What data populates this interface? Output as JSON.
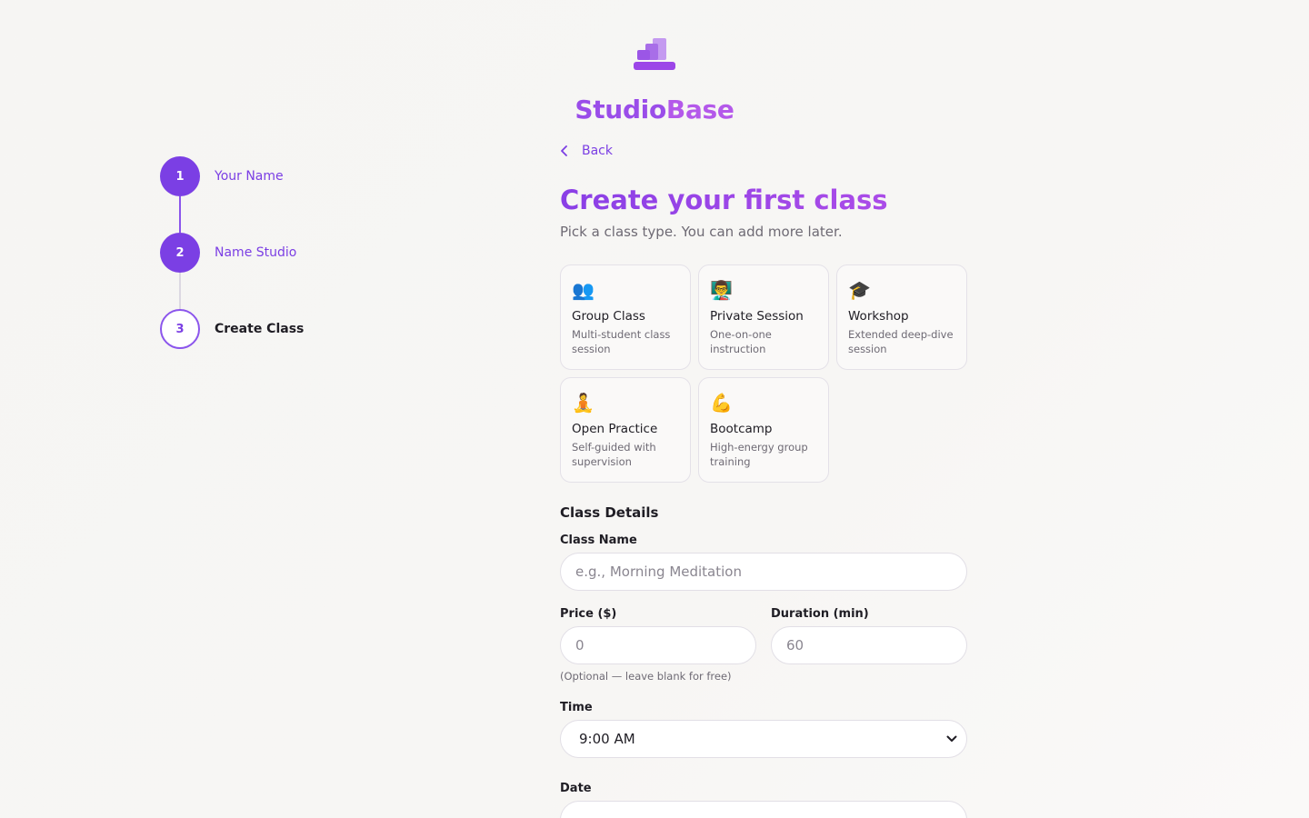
{
  "brand": {
    "name_part1": "Studio",
    "name_part2": "Base"
  },
  "stepper": {
    "steps": [
      {
        "number": "1",
        "label": "Your Name",
        "state": "done"
      },
      {
        "number": "2",
        "label": "Name Studio",
        "state": "done"
      },
      {
        "number": "3",
        "label": "Create Class",
        "state": "current"
      }
    ]
  },
  "main": {
    "back_label": "Back",
    "title": "Create your first class",
    "subtitle": "Pick a class type. You can add more later.",
    "class_types": [
      {
        "icon": "👥",
        "icon_name": "group-icon",
        "name": "Group Class",
        "desc": "Multi-student class session"
      },
      {
        "icon": "👨‍🏫",
        "icon_name": "teacher-icon",
        "name": "Private Session",
        "desc": "One-on-one instruction"
      },
      {
        "icon": "🎓",
        "icon_name": "graduation-cap-icon",
        "name": "Workshop",
        "desc": "Extended deep-dive session"
      },
      {
        "icon": "🧘",
        "icon_name": "meditation-icon",
        "name": "Open Practice",
        "desc": "Self-guided with supervision"
      },
      {
        "icon": "💪",
        "icon_name": "flexed-arm-icon",
        "name": "Bootcamp",
        "desc": "High-energy group training"
      }
    ],
    "details_title": "Class Details",
    "class_name": {
      "label": "Class Name",
      "placeholder": "e.g., Morning Meditation",
      "value": ""
    },
    "price": {
      "label": "Price ($)",
      "placeholder": "0",
      "value": "",
      "hint": "(Optional — leave blank for free)"
    },
    "duration": {
      "label": "Duration (min)",
      "placeholder": "60",
      "value": ""
    },
    "time": {
      "label": "Time",
      "selected": "9:00 AM"
    },
    "date": {
      "label": "Date"
    }
  },
  "colors": {
    "accent": "#7b3fe4",
    "brand_gradient_start": "#8a3fe6",
    "brand_gradient_end": "#b34fe8"
  }
}
